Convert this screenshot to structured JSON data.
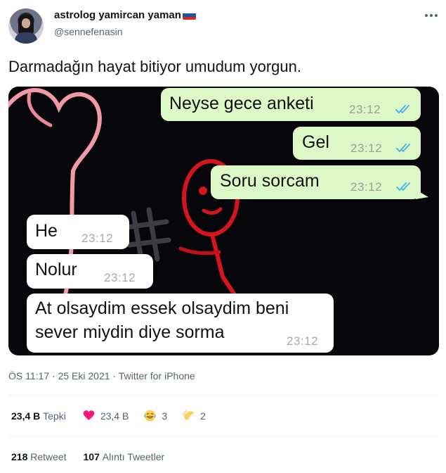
{
  "author": {
    "name": "astrolog yamircan yaman",
    "handle": "@sennefenasin",
    "flag_colors": [
      "#ffffff",
      "#1c57a5",
      "#d52b1e"
    ]
  },
  "tweet": {
    "text": "Darmadağın hayat bitiyor umudum yorgun."
  },
  "chat": {
    "outgoing": [
      {
        "text": "Neyse gece anketi",
        "time": "23:12"
      },
      {
        "text": "Gel",
        "time": "23:12"
      },
      {
        "text": "Soru sorcam",
        "time": "23:12"
      }
    ],
    "incoming": [
      {
        "text": "He",
        "time": "23:12"
      },
      {
        "text": "Nolur",
        "time": "23:12"
      },
      {
        "text_line1": "At olsaydim essek olsaydim beni",
        "text_line2": "sever miydin diye sorma",
        "time": "23:12"
      }
    ],
    "colors": {
      "outgoing_bg": "#dcf8c6",
      "incoming_bg": "#ffffff",
      "read_ticks": "#4fb6ec"
    }
  },
  "meta": {
    "time": "ÖS 11:17",
    "sep1": " · ",
    "date": "25 Eki 2021",
    "sep2": " · ",
    "source": "Twitter for iPhone"
  },
  "reactions": {
    "total_count": "23,4 B",
    "total_label": "Tepki",
    "heart_icon": "heart-icon",
    "heart_count": "23,4 B",
    "laugh_icon": "laughing-face-icon",
    "laugh_count": "3",
    "clap_icon": "clapping-hands-icon",
    "clap_count": "2",
    "heart_color": "#f91880"
  },
  "shares": {
    "retweet_count": "218",
    "retweet_label": "Retweet",
    "quote_count": "107",
    "quote_label": "Alıntı Tweetler"
  }
}
